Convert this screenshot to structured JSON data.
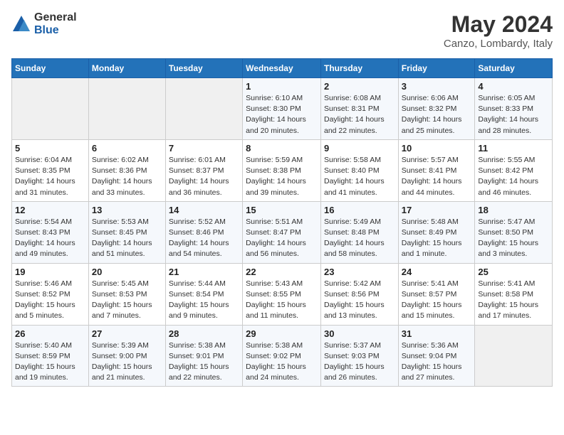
{
  "logo": {
    "general": "General",
    "blue": "Blue"
  },
  "header": {
    "month": "May 2024",
    "location": "Canzo, Lombardy, Italy"
  },
  "weekdays": [
    "Sunday",
    "Monday",
    "Tuesday",
    "Wednesday",
    "Thursday",
    "Friday",
    "Saturday"
  ],
  "weeks": [
    [
      {
        "day": "",
        "info": ""
      },
      {
        "day": "",
        "info": ""
      },
      {
        "day": "",
        "info": ""
      },
      {
        "day": "1",
        "info": "Sunrise: 6:10 AM\nSunset: 8:30 PM\nDaylight: 14 hours\nand 20 minutes."
      },
      {
        "day": "2",
        "info": "Sunrise: 6:08 AM\nSunset: 8:31 PM\nDaylight: 14 hours\nand 22 minutes."
      },
      {
        "day": "3",
        "info": "Sunrise: 6:06 AM\nSunset: 8:32 PM\nDaylight: 14 hours\nand 25 minutes."
      },
      {
        "day": "4",
        "info": "Sunrise: 6:05 AM\nSunset: 8:33 PM\nDaylight: 14 hours\nand 28 minutes."
      }
    ],
    [
      {
        "day": "5",
        "info": "Sunrise: 6:04 AM\nSunset: 8:35 PM\nDaylight: 14 hours\nand 31 minutes."
      },
      {
        "day": "6",
        "info": "Sunrise: 6:02 AM\nSunset: 8:36 PM\nDaylight: 14 hours\nand 33 minutes."
      },
      {
        "day": "7",
        "info": "Sunrise: 6:01 AM\nSunset: 8:37 PM\nDaylight: 14 hours\nand 36 minutes."
      },
      {
        "day": "8",
        "info": "Sunrise: 5:59 AM\nSunset: 8:38 PM\nDaylight: 14 hours\nand 39 minutes."
      },
      {
        "day": "9",
        "info": "Sunrise: 5:58 AM\nSunset: 8:40 PM\nDaylight: 14 hours\nand 41 minutes."
      },
      {
        "day": "10",
        "info": "Sunrise: 5:57 AM\nSunset: 8:41 PM\nDaylight: 14 hours\nand 44 minutes."
      },
      {
        "day": "11",
        "info": "Sunrise: 5:55 AM\nSunset: 8:42 PM\nDaylight: 14 hours\nand 46 minutes."
      }
    ],
    [
      {
        "day": "12",
        "info": "Sunrise: 5:54 AM\nSunset: 8:43 PM\nDaylight: 14 hours\nand 49 minutes."
      },
      {
        "day": "13",
        "info": "Sunrise: 5:53 AM\nSunset: 8:45 PM\nDaylight: 14 hours\nand 51 minutes."
      },
      {
        "day": "14",
        "info": "Sunrise: 5:52 AM\nSunset: 8:46 PM\nDaylight: 14 hours\nand 54 minutes."
      },
      {
        "day": "15",
        "info": "Sunrise: 5:51 AM\nSunset: 8:47 PM\nDaylight: 14 hours\nand 56 minutes."
      },
      {
        "day": "16",
        "info": "Sunrise: 5:49 AM\nSunset: 8:48 PM\nDaylight: 14 hours\nand 58 minutes."
      },
      {
        "day": "17",
        "info": "Sunrise: 5:48 AM\nSunset: 8:49 PM\nDaylight: 15 hours\nand 1 minute."
      },
      {
        "day": "18",
        "info": "Sunrise: 5:47 AM\nSunset: 8:50 PM\nDaylight: 15 hours\nand 3 minutes."
      }
    ],
    [
      {
        "day": "19",
        "info": "Sunrise: 5:46 AM\nSunset: 8:52 PM\nDaylight: 15 hours\nand 5 minutes."
      },
      {
        "day": "20",
        "info": "Sunrise: 5:45 AM\nSunset: 8:53 PM\nDaylight: 15 hours\nand 7 minutes."
      },
      {
        "day": "21",
        "info": "Sunrise: 5:44 AM\nSunset: 8:54 PM\nDaylight: 15 hours\nand 9 minutes."
      },
      {
        "day": "22",
        "info": "Sunrise: 5:43 AM\nSunset: 8:55 PM\nDaylight: 15 hours\nand 11 minutes."
      },
      {
        "day": "23",
        "info": "Sunrise: 5:42 AM\nSunset: 8:56 PM\nDaylight: 15 hours\nand 13 minutes."
      },
      {
        "day": "24",
        "info": "Sunrise: 5:41 AM\nSunset: 8:57 PM\nDaylight: 15 hours\nand 15 minutes."
      },
      {
        "day": "25",
        "info": "Sunrise: 5:41 AM\nSunset: 8:58 PM\nDaylight: 15 hours\nand 17 minutes."
      }
    ],
    [
      {
        "day": "26",
        "info": "Sunrise: 5:40 AM\nSunset: 8:59 PM\nDaylight: 15 hours\nand 19 minutes."
      },
      {
        "day": "27",
        "info": "Sunrise: 5:39 AM\nSunset: 9:00 PM\nDaylight: 15 hours\nand 21 minutes."
      },
      {
        "day": "28",
        "info": "Sunrise: 5:38 AM\nSunset: 9:01 PM\nDaylight: 15 hours\nand 22 minutes."
      },
      {
        "day": "29",
        "info": "Sunrise: 5:38 AM\nSunset: 9:02 PM\nDaylight: 15 hours\nand 24 minutes."
      },
      {
        "day": "30",
        "info": "Sunrise: 5:37 AM\nSunset: 9:03 PM\nDaylight: 15 hours\nand 26 minutes."
      },
      {
        "day": "31",
        "info": "Sunrise: 5:36 AM\nSunset: 9:04 PM\nDaylight: 15 hours\nand 27 minutes."
      },
      {
        "day": "",
        "info": ""
      }
    ]
  ]
}
